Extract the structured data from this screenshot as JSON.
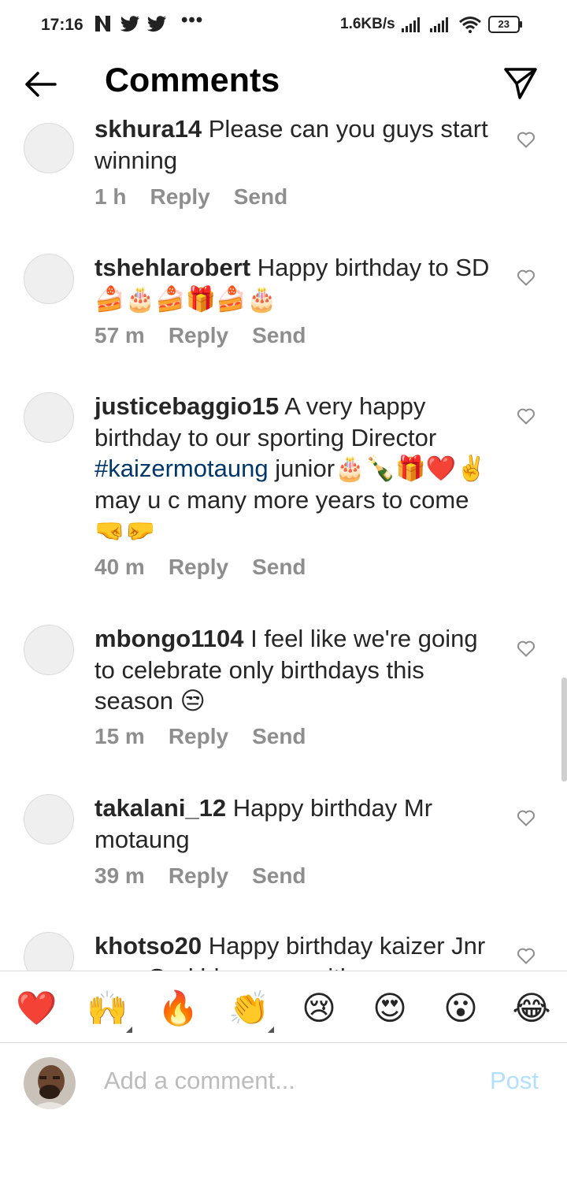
{
  "status_bar": {
    "time": "17:16",
    "speed": "1.6KB/s",
    "battery": "23",
    "more": "•••"
  },
  "header": {
    "title": "Comments"
  },
  "comments": [
    {
      "user": "skhura14",
      "text": " Please can you guys start winning",
      "tag": "",
      "rest": "",
      "time": "1 h",
      "reply": "Reply",
      "send": "Send"
    },
    {
      "user": "tshehlarobert",
      "text": " Happy birthday to SD 🍰🎂🍰🎁🍰🎂",
      "tag": "",
      "rest": "",
      "time": "57 m",
      "reply": "Reply",
      "send": "Send"
    },
    {
      "user": "justicebaggio15",
      "text": " A very happy birthday to our sporting Director ",
      "tag": "#kaizermotaung",
      "rest": " junior🎂🍾🎁❤️✌️may u c many more years to come 🤜🤛",
      "time": "40 m",
      "reply": "Reply",
      "send": "Send"
    },
    {
      "user": "mbongo1104",
      "text": " I feel like we're going to celebrate only birthdays this season 😒",
      "tag": "",
      "rest": "",
      "time": "15 m",
      "reply": "Reply",
      "send": "Send"
    },
    {
      "user": "takalani_12",
      "text": " Happy birthday Mr motaung",
      "tag": "",
      "rest": "",
      "time": "39 m",
      "reply": "Reply",
      "send": "Send"
    },
    {
      "user": "khotso20",
      "text": " Happy birthday kaizer Jnr may God bless you with",
      "tag": "",
      "rest": "",
      "time": "",
      "reply": "",
      "send": ""
    }
  ],
  "emoji_bar": [
    "❤️",
    "🙌",
    "🔥",
    "👏",
    "😢",
    "😍",
    "😮",
    "😂"
  ],
  "compose": {
    "placeholder": "Add a comment...",
    "post": "Post"
  },
  "colors": {
    "hashtag": "#00376b",
    "post_disabled": "#b2dffc",
    "meta": "#8e8e8e"
  }
}
